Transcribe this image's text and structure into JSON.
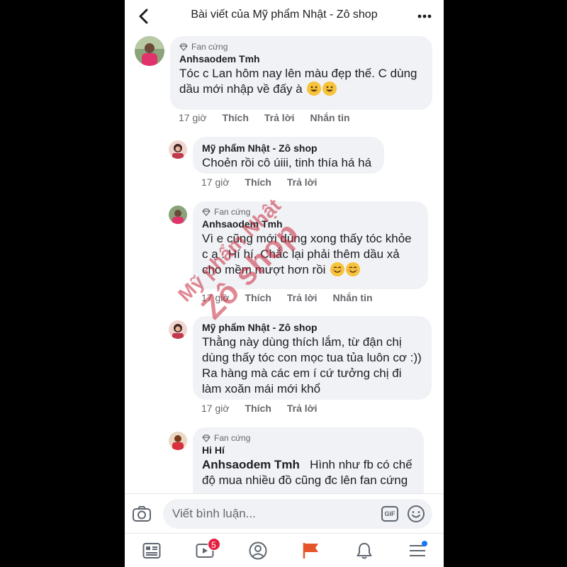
{
  "header": {
    "title": "Bài viết của Mỹ phẩm Nhật - Zô shop",
    "back_icon": "chevron-left-icon",
    "more_icon": "ellipsis-icon"
  },
  "comments": [
    {
      "badge": "Fan cứng",
      "author": "Anhsaodem Tmh",
      "text": "Tóc c Lan hôm nay lên màu đẹp thế. C dùng dầu mới nhập về đấy à",
      "emojis": [
        "grinning-face",
        "grinning-face"
      ],
      "time": "17 giờ",
      "like": "Thích",
      "reply": "Trả lời",
      "message": "Nhắn tin"
    },
    {
      "author": "Mỹ phẩm Nhật - Zô shop",
      "text": "Choẻn rồi cô úiii, tinh thía há há",
      "time": "17 giờ",
      "like": "Thích",
      "reply": "Trả lời"
    },
    {
      "badge": "Fan cứng",
      "author": "Anhsaodem Tmh",
      "text": "Vì e cũng mới dùng xong thấy tóc khỏe c ạ . Hí hí. Chắc lại phải thêm dầu xả cho mềm mượt hơn rồi",
      "emojis": [
        "smiling-face",
        "smiling-face"
      ],
      "time": "17 giờ",
      "like": "Thích",
      "reply": "Trả lời",
      "message": "Nhắn tin"
    },
    {
      "author": "Mỹ phẩm Nhật - Zô shop",
      "text": "Thằng này dùng thích lắm, từ đận chị dùng thấy tóc con mọc tua tủa luôn cơ :)) Ra hàng mà các em í cứ tưởng chị đi làm xoăn mái mới khổ",
      "time": "17 giờ",
      "like": "Thích",
      "reply": "Trả lời"
    },
    {
      "badge": "Fan cứng",
      "author": "Hi Hí",
      "mention": "Anhsaodem Tmh",
      "text": "Hình như fb có chế độ mua nhiều đồ cũng đc lên fan cứng"
    }
  ],
  "watermark": {
    "line1": "Mỹ phẩm Nhật",
    "line2": "Zô shop"
  },
  "composer": {
    "placeholder": "Viết bình luận...",
    "gif_label": "GIF",
    "camera_icon": "camera-icon",
    "emoji_icon": "smiley-icon"
  },
  "tabbar": {
    "items": [
      "news-feed-icon",
      "watch-icon",
      "profile-icon",
      "pages-flag-icon",
      "notifications-bell-icon",
      "menu-icon"
    ],
    "watch_badge": "5"
  },
  "colors": {
    "bubble": "#f0f2f5",
    "meta_text": "#65676b",
    "badge_red": "#e41e3f",
    "flag_active": "#e4552b",
    "watermark": "#c8283c"
  }
}
